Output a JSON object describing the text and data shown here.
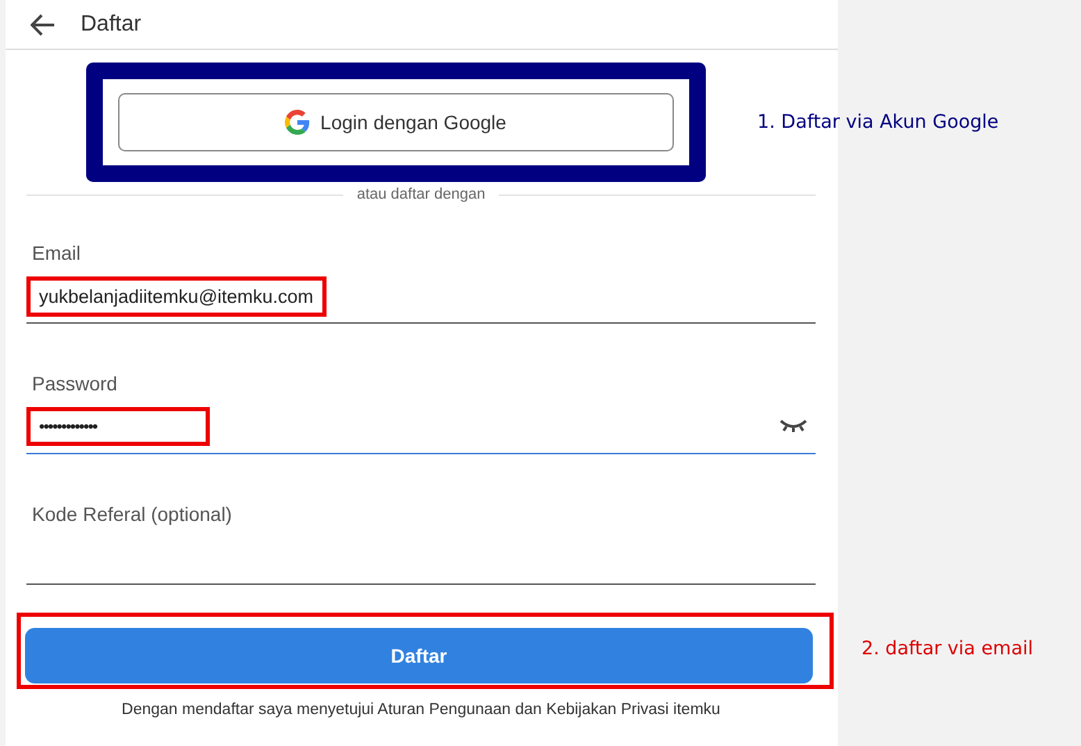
{
  "header": {
    "title": "Daftar"
  },
  "google_button": {
    "label": "Login dengan Google"
  },
  "divider_text": "atau daftar dengan",
  "fields": [
    {
      "kind": "text",
      "label": "Email",
      "value": "yukbelanjadiitemku@itemku.com",
      "focused": false
    },
    {
      "kind": "password",
      "label": "Password",
      "value": "•••••••••••••",
      "focused": true
    },
    {
      "kind": "text",
      "label": "Kode Referal (optional)",
      "focused": false
    }
  ],
  "submit_button": {
    "label": "Daftar"
  },
  "terms": "Dengan mendaftar saya menyetujui Aturan Pengunaan dan Kebijakan Privasi itemku",
  "annotations": [
    {
      "text": "1. Daftar via Akun Google",
      "color": "#000080"
    },
    {
      "text": "2. daftar via email",
      "color": "#dd0000"
    }
  ]
}
